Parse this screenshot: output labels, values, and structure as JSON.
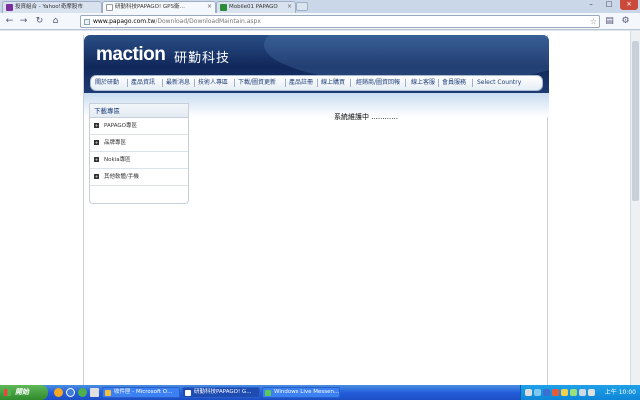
{
  "browser": {
    "tabs": [
      {
        "label": "投資組合 - Yahoo!奇摩股市",
        "active": false
      },
      {
        "label": "研勤科技PAPAGO! GPS衛…",
        "active": true
      },
      {
        "label": "Mobile01 PAPAGO",
        "active": false
      }
    ],
    "url_host": "www.papago.com.tw",
    "url_path": "/Download/DownloadMaintain.aspx"
  },
  "site": {
    "logo": "maction",
    "logo_cn": "研勤科技",
    "nav": [
      "關於研勤",
      "產品資訊",
      "最新消息",
      "技術人專區",
      "下載/圖資更新",
      "產品註冊",
      "線上購買",
      "經銷商/圖資回報",
      "線上客服",
      "會員服務",
      "Select Country"
    ],
    "sidebar": {
      "title": "下載專區",
      "items": [
        "PAPAGO專區",
        "品牌專區",
        "Nokia專區",
        "其他軟體/手機"
      ]
    },
    "maintenance_text": "系統維護中 ............"
  },
  "taskbar": {
    "start_label": "開始",
    "buttons": [
      {
        "label": "收件匣 - Microsoft O…",
        "active": false
      },
      {
        "label": "研勤科技PAPAGO! G…",
        "active": true
      },
      {
        "label": "Windows Live Messen…",
        "active": false
      }
    ],
    "clock": "上午 10:00"
  },
  "colors": {
    "banner": "#10275a",
    "nav_text": "#1b3d78",
    "taskbar": "#245edb",
    "start": "#2f8a2c"
  }
}
